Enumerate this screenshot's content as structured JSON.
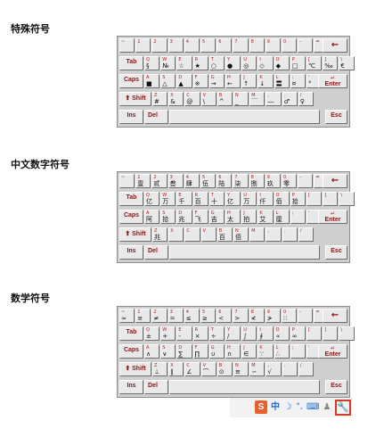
{
  "sections": [
    {
      "title": "特殊符号",
      "rows": [
        [
          {
            "t": "~"
          },
          {
            "t": "1"
          },
          {
            "t": "2"
          },
          {
            "t": "3"
          },
          {
            "t": "4"
          },
          {
            "t": "5"
          },
          {
            "t": "6"
          },
          {
            "t": "7"
          },
          {
            "t": "8"
          },
          {
            "t": "9"
          },
          {
            "t": "0"
          },
          {
            "t": "-"
          },
          {
            "t": "="
          },
          {
            "fn": "backspace",
            "label": "←"
          }
        ],
        [
          {
            "fn": "tab",
            "label": "Tab"
          },
          {
            "t": "Q",
            "b": "§"
          },
          {
            "t": "W",
            "b": "№"
          },
          {
            "t": "E",
            "b": "☆"
          },
          {
            "t": "R",
            "b": "★"
          },
          {
            "t": "T",
            "b": "○"
          },
          {
            "t": "Y",
            "b": "●"
          },
          {
            "t": "U",
            "b": "◎"
          },
          {
            "t": "I",
            "b": "◇"
          },
          {
            "t": "O",
            "b": "◆"
          },
          {
            "t": "P",
            "b": "□"
          },
          {
            "t": "[",
            "b": "℃"
          },
          {
            "t": "]",
            "b": "‰"
          },
          {
            "t": "\\",
            "b": "€"
          }
        ],
        [
          {
            "fn": "caps",
            "label": "Caps"
          },
          {
            "t": "A",
            "b": "■"
          },
          {
            "t": "S",
            "b": "△"
          },
          {
            "t": "D",
            "b": "▲"
          },
          {
            "t": "F",
            "b": "※"
          },
          {
            "t": "G",
            "b": "→"
          },
          {
            "t": "H",
            "b": "←"
          },
          {
            "t": "J",
            "b": "↑"
          },
          {
            "t": "K",
            "b": "↓"
          },
          {
            "t": "L",
            "b": "〓"
          },
          {
            "t": ";",
            "b": "¤"
          },
          {
            "t": "'",
            "b": "°"
          },
          {
            "fn": "enter",
            "label": "Enter"
          }
        ],
        [
          {
            "fn": "shift",
            "label": "Shift"
          },
          {
            "t": "Z",
            "b": "#"
          },
          {
            "t": "X",
            "b": "&"
          },
          {
            "t": "C",
            "b": "@"
          },
          {
            "t": "V",
            "b": "\\"
          },
          {
            "t": "B",
            "b": "^"
          },
          {
            "t": "N",
            "b": "_"
          },
          {
            "t": "M",
            "b": "￣"
          },
          {
            "t": ",",
            "b": "―"
          },
          {
            "t": ".",
            "b": "♂"
          },
          {
            "t": "/",
            "b": "♀"
          }
        ],
        [
          {
            "fn": "ins",
            "label": "Ins"
          },
          {
            "fn": "del",
            "label": "Del"
          },
          {
            "fn": "space",
            "label": ""
          },
          {
            "fn": "esc",
            "label": "Esc"
          }
        ]
      ]
    },
    {
      "title": "中文数字符号",
      "rows": [
        [
          {
            "t": "~"
          },
          {
            "t": "1",
            "b": "壹"
          },
          {
            "t": "2",
            "b": "贰"
          },
          {
            "t": "3",
            "b": "叁"
          },
          {
            "t": "4",
            "b": "肆"
          },
          {
            "t": "5",
            "b": "伍"
          },
          {
            "t": "6",
            "b": "陆"
          },
          {
            "t": "7",
            "b": "柒"
          },
          {
            "t": "8",
            "b": "捌"
          },
          {
            "t": "9",
            "b": "玖"
          },
          {
            "t": "0",
            "b": "零"
          },
          {
            "t": "-"
          },
          {
            "t": "="
          },
          {
            "fn": "backspace",
            "label": "←"
          }
        ],
        [
          {
            "fn": "tab",
            "label": "Tab"
          },
          {
            "t": "Q",
            "b": "亿"
          },
          {
            "t": "W",
            "b": "万"
          },
          {
            "t": "E",
            "b": "千"
          },
          {
            "t": "R",
            "b": "百"
          },
          {
            "t": "T",
            "b": "十"
          },
          {
            "t": "Y",
            "b": "亿"
          },
          {
            "t": "U",
            "b": "万"
          },
          {
            "t": "I",
            "b": "仟"
          },
          {
            "t": "O",
            "b": "佰"
          },
          {
            "t": "P",
            "b": "拾"
          },
          {
            "t": "["
          },
          {
            "t": "]"
          },
          {
            "t": "\\"
          }
        ],
        [
          {
            "fn": "caps",
            "label": "Caps"
          },
          {
            "t": "A",
            "b": "阿"
          },
          {
            "t": "S",
            "b": "拾"
          },
          {
            "t": "D",
            "b": "兆"
          },
          {
            "t": "F",
            "b": "飞"
          },
          {
            "t": "G",
            "b": "吉"
          },
          {
            "t": "H",
            "b": "太"
          },
          {
            "t": "J",
            "b": "拍"
          },
          {
            "t": "K",
            "b": "艾"
          },
          {
            "t": "L",
            "b": "厘"
          },
          {
            "t": ";"
          },
          {
            "t": "'"
          },
          {
            "fn": "enter",
            "label": "Enter"
          }
        ],
        [
          {
            "fn": "shift",
            "label": "Shift"
          },
          {
            "t": "Z",
            "b": "兆"
          },
          {
            "t": "X"
          },
          {
            "t": "C"
          },
          {
            "t": "V"
          },
          {
            "t": "B",
            "b": "百"
          },
          {
            "t": "N",
            "b": "佰"
          },
          {
            "t": "M"
          },
          {
            "t": ","
          },
          {
            "t": "."
          },
          {
            "t": "/"
          }
        ],
        [
          {
            "fn": "ins",
            "label": "Ins"
          },
          {
            "fn": "del",
            "label": "Del"
          },
          {
            "fn": "space",
            "label": ""
          },
          {
            "fn": "esc",
            "label": "Esc"
          }
        ]
      ]
    },
    {
      "title": "数学符号",
      "rows": [
        [
          {
            "t": "~",
            "b": "≈"
          },
          {
            "t": "1",
            "b": "≡"
          },
          {
            "t": "2",
            "b": "≠"
          },
          {
            "t": "3",
            "b": "="
          },
          {
            "t": "4",
            "b": "≤"
          },
          {
            "t": "5",
            "b": "≥"
          },
          {
            "t": "6",
            "b": "<"
          },
          {
            "t": "7",
            "b": ">"
          },
          {
            "t": "8",
            "b": "≮"
          },
          {
            "t": "9",
            "b": "≯"
          },
          {
            "t": "0",
            "b": "∷"
          },
          {
            "t": "-"
          },
          {
            "t": "="
          },
          {
            "fn": "backspace",
            "label": "←"
          }
        ],
        [
          {
            "fn": "tab",
            "label": "Tab"
          },
          {
            "t": "Q",
            "b": "±"
          },
          {
            "t": "W",
            "b": "+"
          },
          {
            "t": "E",
            "b": "-"
          },
          {
            "t": "R",
            "b": "×"
          },
          {
            "t": "T",
            "b": "÷"
          },
          {
            "t": "Y",
            "b": "/"
          },
          {
            "t": "U",
            "b": "∫"
          },
          {
            "t": "I",
            "b": "∮"
          },
          {
            "t": "O",
            "b": "∝"
          },
          {
            "t": "P",
            "b": "∞"
          },
          {
            "t": "["
          },
          {
            "t": "]"
          },
          {
            "t": "\\"
          }
        ],
        [
          {
            "fn": "caps",
            "label": "Caps"
          },
          {
            "t": "A",
            "b": "∧"
          },
          {
            "t": "S",
            "b": "∨"
          },
          {
            "t": "D",
            "b": "∑"
          },
          {
            "t": "F",
            "b": "∏"
          },
          {
            "t": "G",
            "b": "∪"
          },
          {
            "t": "H",
            "b": "∩"
          },
          {
            "t": "J",
            "b": "∈"
          },
          {
            "t": "K",
            "b": "∵"
          },
          {
            "t": "L",
            "b": "∴"
          },
          {
            "t": ";"
          },
          {
            "t": "'"
          },
          {
            "fn": "enter",
            "label": "Enter"
          }
        ],
        [
          {
            "fn": "shift",
            "label": "Shift"
          },
          {
            "t": "Z",
            "b": "⊥"
          },
          {
            "t": "X",
            "b": "∥"
          },
          {
            "t": "C",
            "b": "∠"
          },
          {
            "t": "V",
            "b": "⌒"
          },
          {
            "t": "B",
            "b": "⊙"
          },
          {
            "t": "N",
            "b": "≌"
          },
          {
            "t": "M",
            "b": "∽"
          },
          {
            "t": ",",
            "b": "√"
          },
          {
            "t": "."
          },
          {
            "t": "/"
          }
        ],
        [
          {
            "fn": "ins",
            "label": "Ins"
          },
          {
            "fn": "del",
            "label": "Del"
          },
          {
            "fn": "space",
            "label": ""
          },
          {
            "fn": "esc",
            "label": "Esc"
          }
        ]
      ]
    }
  ],
  "taskbar": {
    "sogou": "S",
    "lang": "中",
    "items": [
      "sogou-icon",
      "chinese-mode-icon",
      "moon-icon",
      "punctuation-icon",
      "keyboard-icon",
      "user-icon",
      "wrench-icon"
    ]
  }
}
